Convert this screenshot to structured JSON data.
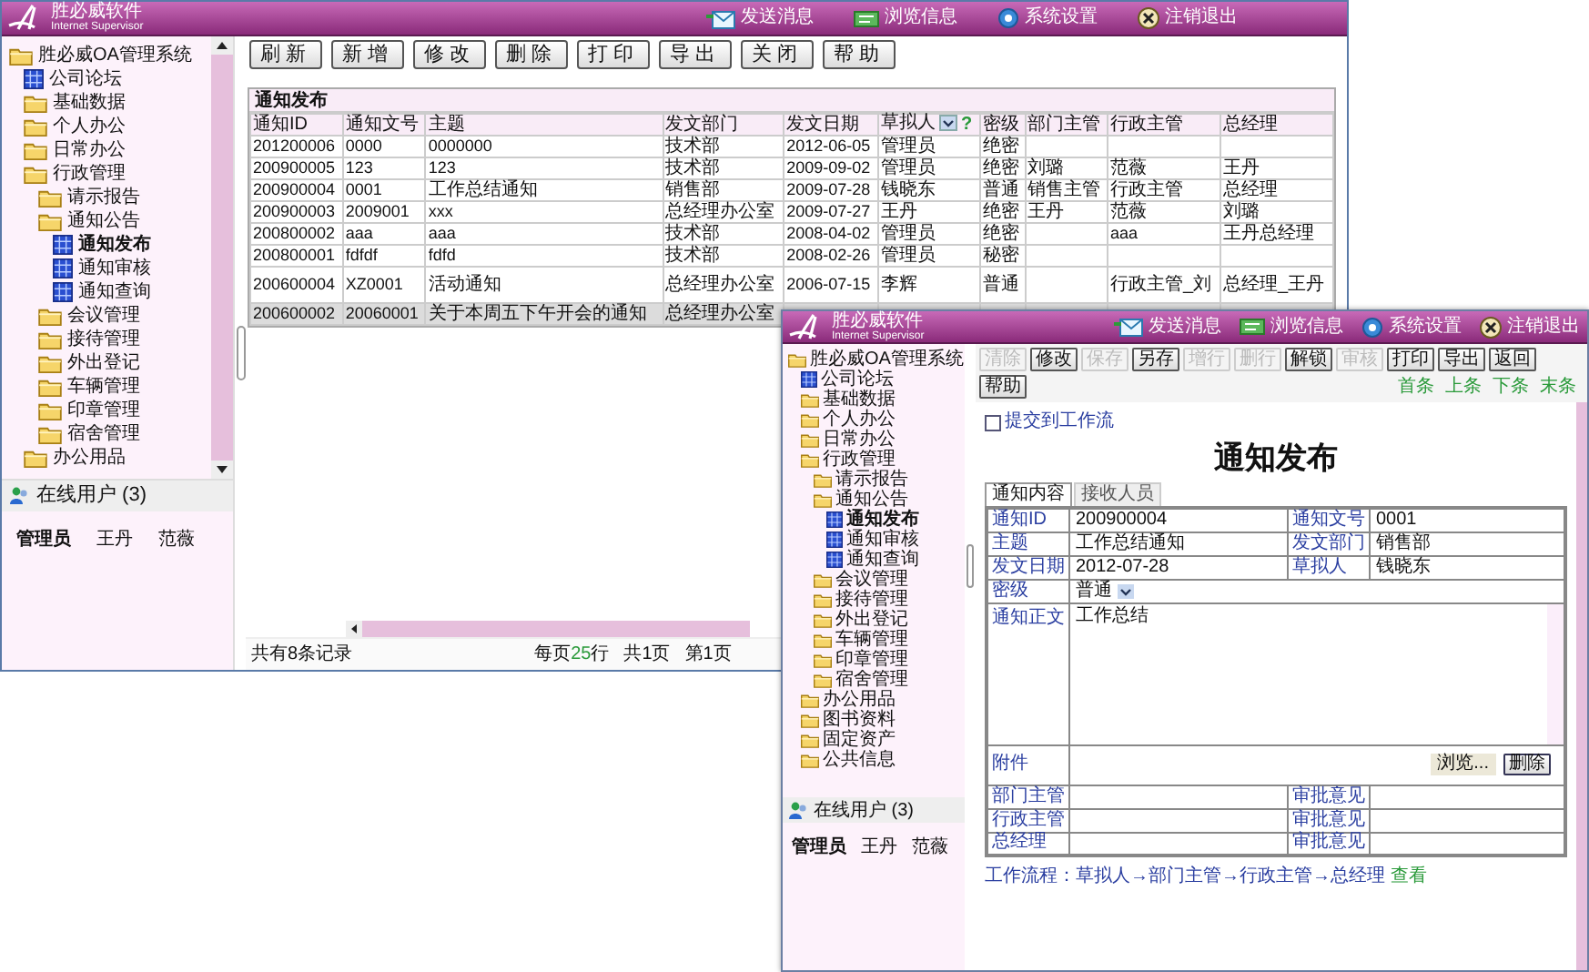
{
  "main_window": {
    "logo": {
      "name": "胜必威软件",
      "subtitle": "Internet Supervisor"
    },
    "top_menu": [
      {
        "label": "发送消息"
      },
      {
        "label": "浏览信息"
      },
      {
        "label": "系统设置"
      },
      {
        "label": "注销退出"
      }
    ],
    "sidebar": {
      "tree": [
        {
          "label": "胜必威OA管理系统",
          "kind": "folder",
          "selected": false,
          "children": [
            {
              "label": "公司论坛",
              "kind": "page",
              "selected": false
            },
            {
              "label": "基础数据",
              "kind": "folder",
              "selected": false
            },
            {
              "label": "个人办公",
              "kind": "folder",
              "selected": false
            },
            {
              "label": "日常办公",
              "kind": "folder",
              "selected": false
            },
            {
              "label": "行政管理",
              "kind": "folder",
              "selected": false,
              "children": [
                {
                  "label": "请示报告",
                  "kind": "folder",
                  "selected": false
                },
                {
                  "label": "通知公告",
                  "kind": "folder",
                  "selected": false,
                  "children": [
                    {
                      "label": "通知发布",
                      "kind": "page",
                      "selected": true
                    },
                    {
                      "label": "通知审核",
                      "kind": "page",
                      "selected": false
                    },
                    {
                      "label": "通知查询",
                      "kind": "page",
                      "selected": false
                    }
                  ]
                },
                {
                  "label": "会议管理",
                  "kind": "folder",
                  "selected": false
                },
                {
                  "label": "接待管理",
                  "kind": "folder",
                  "selected": false
                },
                {
                  "label": "外出登记",
                  "kind": "folder",
                  "selected": false
                },
                {
                  "label": "车辆管理",
                  "kind": "folder",
                  "selected": false
                },
                {
                  "label": "印章管理",
                  "kind": "folder",
                  "selected": false
                },
                {
                  "label": "宿舍管理",
                  "kind": "folder",
                  "selected": false
                }
              ]
            },
            {
              "label": "办公用品",
              "kind": "folder",
              "selected": false
            }
          ]
        }
      ],
      "online_users": {
        "title": "在线用户 (3)",
        "users": [
          {
            "name": "管理员",
            "current": true
          },
          {
            "name": "王丹",
            "current": false
          },
          {
            "name": "范薇",
            "current": false
          }
        ]
      }
    },
    "toolbar": [
      "刷新",
      "新增",
      "修改",
      "删除",
      "打印",
      "导出",
      "关闭",
      "帮助"
    ],
    "panel": {
      "title": "通知发布",
      "columns": [
        {
          "label": "通知ID"
        },
        {
          "label": "通知文号"
        },
        {
          "label": "主题"
        },
        {
          "label": "发文部门"
        },
        {
          "label": "发文日期"
        },
        {
          "label": "草拟人",
          "filter": true,
          "hint": "?"
        },
        {
          "label": "密级"
        },
        {
          "label": "部门主管"
        },
        {
          "label": "行政主管"
        },
        {
          "label": "总经理"
        }
      ],
      "rows": [
        {
          "selected": false,
          "cells": [
            "201200006",
            "0000",
            "0000000",
            "技术部",
            "2012-06-05",
            "管理员",
            "绝密",
            "",
            "",
            ""
          ]
        },
        {
          "selected": false,
          "cells": [
            "200900005",
            "123",
            "123",
            "技术部",
            "2009-09-02",
            "管理员",
            "绝密",
            "刘璐",
            "范薇",
            "王丹"
          ]
        },
        {
          "selected": false,
          "cells": [
            "200900004",
            "0001",
            "工作总结通知",
            "销售部",
            "2009-07-28",
            "钱晓东",
            "普通",
            "销售主管",
            "行政主管",
            "总经理"
          ]
        },
        {
          "selected": false,
          "cells": [
            "200900003",
            "2009001",
            "xxx",
            "总经理办公室",
            "2009-07-27",
            "王丹",
            "绝密",
            "王丹",
            "范薇",
            "刘璐"
          ]
        },
        {
          "selected": false,
          "cells": [
            "200800002",
            "aaa",
            "aaa",
            "技术部",
            "2008-04-02",
            "管理员",
            "绝密",
            "",
            "aaa",
            "王丹总经理"
          ]
        },
        {
          "selected": false,
          "cells": [
            "200800001",
            "fdfdf",
            "fdfd",
            "技术部",
            "2008-02-26",
            "管理员",
            "秘密",
            "",
            "",
            ""
          ]
        },
        {
          "selected": false,
          "cells": [
            "200600004",
            "XZ0001",
            "活动通知",
            "总经理办公室",
            "2006-07-15",
            "李辉",
            "普通",
            "",
            "行政主管_刘",
            "总经理_王丹"
          ]
        },
        {
          "selected": true,
          "cells": [
            "200600002",
            "20060001",
            "关于本周五下午开会的通知",
            "总经理办公室"
          ]
        }
      ]
    },
    "status_bar": {
      "total": "共有8条记录",
      "page_size": {
        "prefix": "每页",
        "count": "25",
        "suffix": "行"
      },
      "pages": "共1页",
      "current": "第1页"
    }
  },
  "detail_window": {
    "logo": {
      "name": "胜必威软件",
      "subtitle": "Internet Supervisor"
    },
    "top_menu": [
      {
        "label": "发送消息"
      },
      {
        "label": "浏览信息"
      },
      {
        "label": "系统设置"
      },
      {
        "label": "注销退出"
      }
    ],
    "sidebar": {
      "tree": [
        {
          "label": "胜必威OA管理系统",
          "kind": "folder",
          "selected": false,
          "children": [
            {
              "label": "公司论坛",
              "kind": "page",
              "selected": false
            },
            {
              "label": "基础数据",
              "kind": "folder",
              "selected": false
            },
            {
              "label": "个人办公",
              "kind": "folder",
              "selected": false
            },
            {
              "label": "日常办公",
              "kind": "folder",
              "selected": false
            },
            {
              "label": "行政管理",
              "kind": "folder",
              "selected": false,
              "children": [
                {
                  "label": "请示报告",
                  "kind": "folder",
                  "selected": false
                },
                {
                  "label": "通知公告",
                  "kind": "folder",
                  "selected": false,
                  "children": [
                    {
                      "label": "通知发布",
                      "kind": "page",
                      "selected": true
                    },
                    {
                      "label": "通知审核",
                      "kind": "page",
                      "selected": false
                    },
                    {
                      "label": "通知查询",
                      "kind": "page",
                      "selected": false
                    }
                  ]
                },
                {
                  "label": "会议管理",
                  "kind": "folder",
                  "selected": false
                },
                {
                  "label": "接待管理",
                  "kind": "folder",
                  "selected": false
                },
                {
                  "label": "外出登记",
                  "kind": "folder",
                  "selected": false
                },
                {
                  "label": "车辆管理",
                  "kind": "folder",
                  "selected": false
                },
                {
                  "label": "印章管理",
                  "kind": "folder",
                  "selected": false
                },
                {
                  "label": "宿舍管理",
                  "kind": "folder",
                  "selected": false
                }
              ]
            },
            {
              "label": "办公用品",
              "kind": "folder",
              "selected": false
            },
            {
              "label": "图书资料",
              "kind": "folder",
              "selected": false
            },
            {
              "label": "固定资产",
              "kind": "folder",
              "selected": false
            },
            {
              "label": "公共信息",
              "kind": "folder",
              "selected": false
            }
          ]
        }
      ],
      "online_users": {
        "title": "在线用户 (3)",
        "users": [
          {
            "name": "管理员",
            "current": true
          },
          {
            "name": "王丹",
            "current": false
          },
          {
            "name": "范薇",
            "current": false
          }
        ]
      }
    },
    "toolbar": [
      {
        "label": "清除",
        "disabled": true
      },
      {
        "label": "修改",
        "disabled": false
      },
      {
        "label": "保存",
        "disabled": true
      },
      {
        "label": "另存",
        "disabled": false
      },
      {
        "label": "增行",
        "disabled": true
      },
      {
        "label": "删行",
        "disabled": true
      },
      {
        "label": "解锁",
        "disabled": false
      },
      {
        "label": "审核",
        "disabled": true
      },
      {
        "label": "打印",
        "disabled": false
      },
      {
        "label": "导出",
        "disabled": false
      },
      {
        "label": "返回",
        "disabled": false
      },
      {
        "label": "帮助",
        "disabled": false
      }
    ],
    "record_nav": [
      "首条",
      "上条",
      "下条",
      "末条"
    ],
    "workflow_checkbox": {
      "label": "提交到工作流",
      "checked": false
    },
    "title": "通知发布",
    "tabs": [
      {
        "label": "通知内容",
        "selected": true
      },
      {
        "label": "接收人员",
        "selected": false
      }
    ],
    "form": [
      {
        "kind": "pair",
        "label": "通知ID",
        "value": "200900004",
        "label2": "通知文号",
        "value2": "0001"
      },
      {
        "kind": "pair",
        "label": "主题",
        "value": "工作总结通知",
        "label2": "发文部门",
        "value2": "销售部"
      },
      {
        "kind": "pair",
        "label": "发文日期",
        "value": "2012-07-28",
        "label2": "草拟人",
        "value2": "钱晓东"
      },
      {
        "kind": "select",
        "label": "密级",
        "value": "普通"
      },
      {
        "kind": "textarea",
        "label": "通知正文",
        "value": "工作总结"
      },
      {
        "kind": "attachment",
        "label": "附件",
        "browse": "浏览...",
        "delete": "删除"
      },
      {
        "kind": "approval",
        "label": "部门主管",
        "label2": "审批意见"
      },
      {
        "kind": "approval",
        "label": "行政主管",
        "label2": "审批意见"
      },
      {
        "kind": "approval",
        "label": "总经理",
        "label2": "审批意见"
      }
    ],
    "workflow": {
      "text": "工作流程：草拟人→部门主管→行政主管→总经理",
      "link": "查看"
    }
  }
}
